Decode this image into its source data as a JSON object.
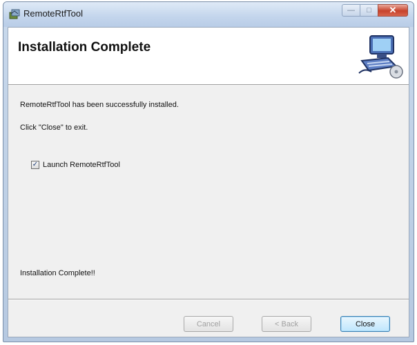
{
  "window": {
    "title": "RemoteRtfTool",
    "caption_buttons": [
      "minimize",
      "maximize",
      "close"
    ]
  },
  "banner": {
    "title": "Installation Complete",
    "art_icon": "computer-setup-icon"
  },
  "messages": {
    "installed": "RemoteRtfTool has been successfully installed.",
    "instruction": "Click \"Close\" to exit."
  },
  "launch_option": {
    "label": "Launch RemoteRtfTool",
    "checked": true
  },
  "status_text": "Installation Complete!!",
  "buttons": {
    "cancel": {
      "label": "Cancel",
      "enabled": false
    },
    "back": {
      "label": "< Back",
      "enabled": false
    },
    "close": {
      "label": "Close",
      "enabled": true
    }
  },
  "colors": {
    "close_caption": "#c7422b",
    "default_button_border": "#3c7fb1"
  }
}
